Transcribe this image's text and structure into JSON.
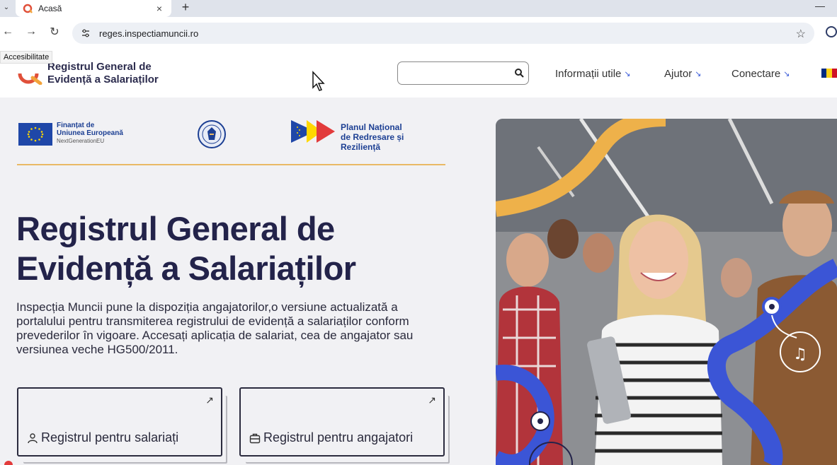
{
  "browser": {
    "tab_title": "Acasă",
    "tab_close": "×",
    "new_tab": "+",
    "minimize": "—",
    "url": "reges.inspectiamuncii.ro",
    "menu": "⌄",
    "back": "←",
    "forward": "→",
    "reload": "↻",
    "star": "☆"
  },
  "header": {
    "accessibility": "Accesibilitate",
    "logo_line1": "Registrul General de",
    "logo_line2": "Evidență a Salariaților",
    "search_placeholder": "",
    "nav": [
      {
        "label": "Informații utile",
        "arrow": "↘"
      },
      {
        "label": "Ajutor",
        "arrow": "↘"
      },
      {
        "label": "Conectare",
        "arrow": "↘"
      }
    ],
    "flag_colors": [
      "#002b7f",
      "#fcd116",
      "#ce1126"
    ]
  },
  "funding": {
    "eu_line1": "Finanțat de",
    "eu_line2": "Uniunea Europeană",
    "eu_line3": "NextGenerationEU",
    "pnrr_line1": "Planul Național",
    "pnrr_line2": "de Redresare și Reziliență"
  },
  "hero": {
    "title_line1": "Registrul General de",
    "title_line2": "Evidență a Salariaților",
    "description": "Inspecția Muncii pune la dispoziția angajatorilor,o versiune actualizată a portalului pentru transmiterea registrului de evidență a salariaților conform prevederilor în vigoare. Accesați aplicația de salariat, cea de angajator sau versiunea veche HG500/2011.",
    "cards": [
      {
        "label": "Registrul pentru salariați",
        "arrow": "↗",
        "icon": "person-icon"
      },
      {
        "label": "Registrul pentru angajatori",
        "arrow": "↗",
        "icon": "briefcase-icon"
      }
    ]
  },
  "colors": {
    "accent_blue": "#3a5bd9",
    "accent_orange": "#e9a23b",
    "title_navy": "#23234a"
  }
}
